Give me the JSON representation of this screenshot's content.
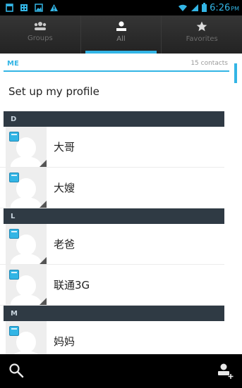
{
  "status_bar": {
    "time": "6:26",
    "ampm": "PM",
    "left_icons": [
      "notification-icon",
      "bbm-icon",
      "image-icon",
      "warning-icon"
    ],
    "right_icons": [
      "wifi-icon",
      "signal-icon",
      "battery-icon"
    ]
  },
  "tabs": [
    {
      "label": "Groups",
      "icon": "groups-icon",
      "active": false
    },
    {
      "label": "All",
      "icon": "person-icon",
      "active": true
    },
    {
      "label": "Favorites",
      "icon": "star-icon",
      "active": false
    }
  ],
  "me_section": {
    "label": "ME",
    "count": "15 contacts",
    "profile_text": "Set up my profile"
  },
  "sections": [
    {
      "letter": "D",
      "contacts": [
        {
          "name": "大哥"
        },
        {
          "name": "大嫂"
        }
      ]
    },
    {
      "letter": "L",
      "contacts": [
        {
          "name": "老爸"
        },
        {
          "name": "联通3G"
        }
      ]
    },
    {
      "letter": "M",
      "contacts": [
        {
          "name": "妈妈"
        }
      ]
    }
  ],
  "bottom_bar": {
    "icons": [
      "search-icon",
      "add-contact-icon"
    ]
  },
  "colors": {
    "accent": "#33b5e5",
    "section_bg": "#2f3a44",
    "tab_bg": "#2b2b2b"
  }
}
